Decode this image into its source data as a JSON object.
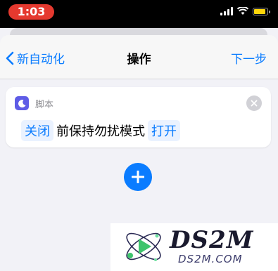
{
  "status_bar": {
    "time": "1:03",
    "time_pill_color": "#e5392f",
    "battery_color": "#ffd60a"
  },
  "nav": {
    "back_label": "新自动化",
    "title": "操作",
    "next_label": "下一步"
  },
  "action_card": {
    "app_label": "脚本",
    "app_icon": "moon-icon",
    "tokens": {
      "state": "关闭",
      "text": "前保持勿扰模式",
      "mode": "打开"
    }
  },
  "add_button": {
    "icon": "plus-icon"
  },
  "watermark": {
    "main": "DS2M",
    "sub": "DS2M.COM"
  },
  "colors": {
    "accent": "#0a7cff",
    "background": "#f2f2f7"
  }
}
